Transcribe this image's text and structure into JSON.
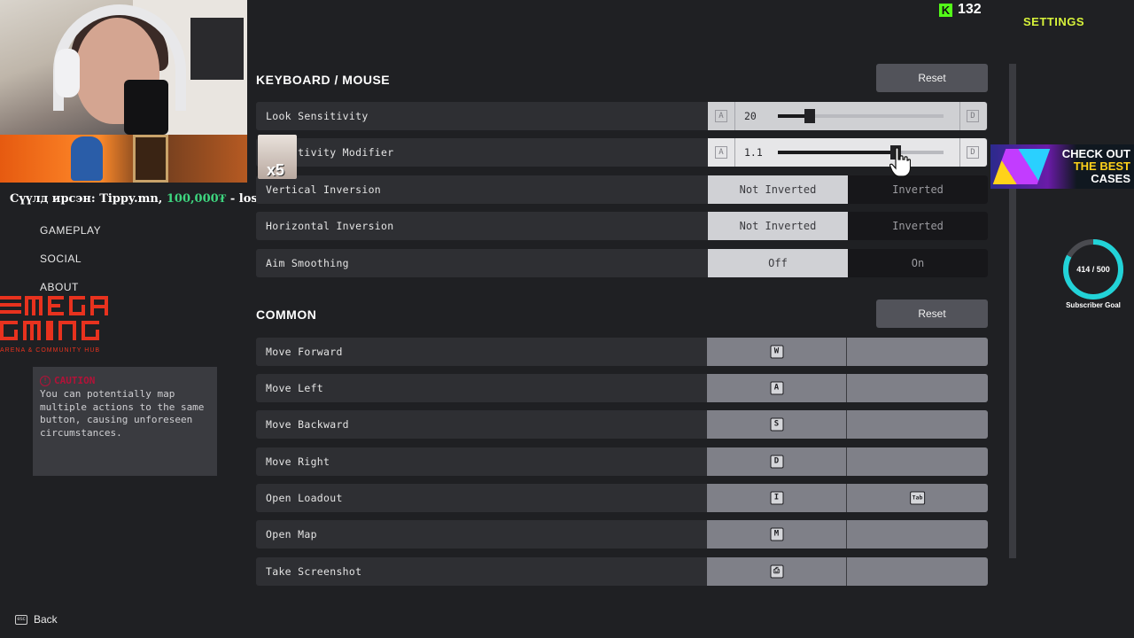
{
  "header": {
    "title": "SETTINGS",
    "kick_count": "132",
    "kick_logo": "K"
  },
  "overlay": {
    "donation_alert": {
      "prefix": "Сүүлд ирсэн: Tippy.mn, ",
      "amount": "100,000₮",
      "suffix": " - losol"
    },
    "mega_logo": {
      "text": "MEGA GMNG",
      "subtitle": "ARENA & COMMUNITY HUB"
    },
    "multiplier": "x5",
    "promo": {
      "line1": "CHECK OUT",
      "line2": "THE BEST",
      "line3": "CASES"
    },
    "subscriber_goal": {
      "current": 414,
      "target": 500,
      "text": "414 / 500",
      "label": "Subscriber Goal",
      "color": "#22d3d8"
    }
  },
  "sidebar": {
    "items": [
      {
        "label": "GAMEPLAY"
      },
      {
        "label": "SOCIAL"
      },
      {
        "label": "ABOUT"
      }
    ],
    "caution": {
      "title": "CAUTION",
      "body": "You can potentially map multiple actions to the same button, causing unforeseen circumstances."
    },
    "back_label": "Back"
  },
  "keyboard_mouse": {
    "title": "KEYBOARD / MOUSE",
    "reset_label": "Reset",
    "slider_icon_left": "A",
    "slider_icon_right": "D",
    "look_sensitivity": {
      "label": "Look Sensitivity",
      "value": "20",
      "fraction": 0.19
    },
    "sensitivity_modifier": {
      "label": "Sensitivity Modifier",
      "value": "1.1",
      "fraction": 0.71
    },
    "vertical_inversion": {
      "label": "Vertical Inversion",
      "option_a": "Not Inverted",
      "option_b": "Inverted"
    },
    "horizontal_inversion": {
      "label": "Horizontal Inversion",
      "option_a": "Not Inverted",
      "option_b": "Inverted"
    },
    "aim_smoothing": {
      "label": "Aim Smoothing",
      "option_a": "Off",
      "option_b": "On"
    }
  },
  "common": {
    "title": "COMMON",
    "reset_label": "Reset",
    "rows": [
      {
        "label": "Move Forward",
        "primary": "W",
        "secondary": ""
      },
      {
        "label": "Move Left",
        "primary": "A",
        "secondary": ""
      },
      {
        "label": "Move Backward",
        "primary": "S",
        "secondary": ""
      },
      {
        "label": "Move Right",
        "primary": "D",
        "secondary": ""
      },
      {
        "label": "Open Loadout",
        "primary": "I",
        "secondary": "Tab"
      },
      {
        "label": "Open Map",
        "primary": "M",
        "secondary": ""
      },
      {
        "label": "Take Screenshot",
        "primary": "⎙",
        "secondary": ""
      }
    ]
  }
}
